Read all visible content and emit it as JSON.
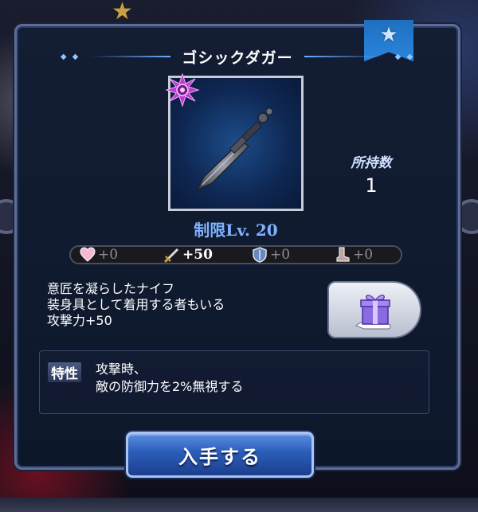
{
  "title": "ゴシックダガー",
  "owned": {
    "label": "所持数",
    "value": "1"
  },
  "level_limit": "制限Lv. 20",
  "stats": [
    {
      "icon": "heart-icon",
      "value": "+0",
      "highlight": false
    },
    {
      "icon": "sword-icon",
      "value": "+50",
      "highlight": true
    },
    {
      "icon": "shield-icon",
      "value": "+0",
      "highlight": false
    },
    {
      "icon": "boot-icon",
      "value": "+0",
      "highlight": false
    }
  ],
  "description": {
    "line1": "意匠を凝らしたナイフ",
    "line2": "装身具として着用する者もいる",
    "line3": "攻撃力+50"
  },
  "trait": {
    "tag": "特性",
    "line1": "攻撃時、",
    "line2": "敵の防御力を2%無視する"
  },
  "acquire_label": "入手する",
  "colors": {
    "accent": "#2a5cb8",
    "level": "#7fb2ff",
    "badge": "#c040d0"
  }
}
